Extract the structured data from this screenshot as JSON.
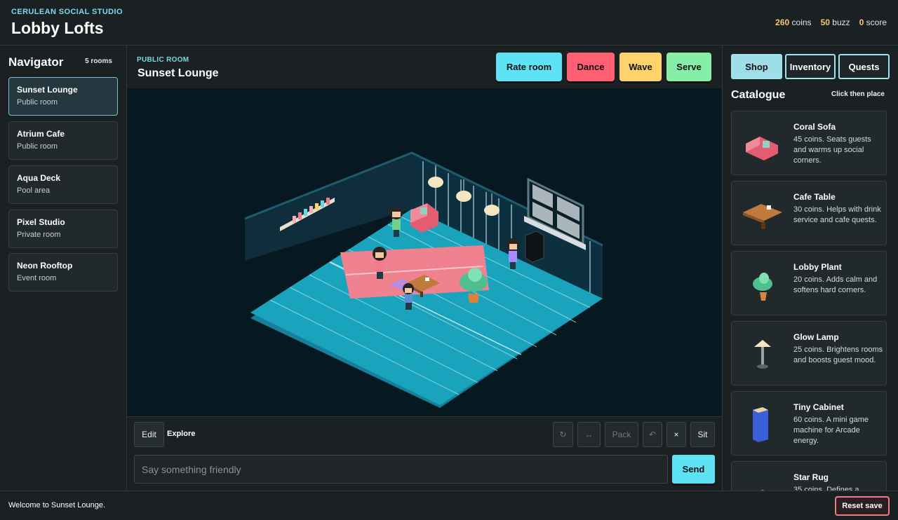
{
  "header": {
    "studio": "CERULEAN SOCIAL STUDIO",
    "title": "Lobby Lofts"
  },
  "stats": {
    "coins_value": "260",
    "coins_label": "coins",
    "buzz_value": "50",
    "buzz_label": "buzz",
    "score_value": "0",
    "score_label": "score"
  },
  "navigator": {
    "title": "Navigator",
    "count": "5 rooms",
    "rooms": [
      {
        "name": "Sunset Lounge",
        "type": "Public room"
      },
      {
        "name": "Atrium Cafe",
        "type": "Public room"
      },
      {
        "name": "Aqua Deck",
        "type": "Pool area"
      },
      {
        "name": "Pixel Studio",
        "type": "Private room"
      },
      {
        "name": "Neon Rooftop",
        "type": "Event room"
      }
    ]
  },
  "room": {
    "type": "PUBLIC ROOM",
    "name": "Sunset Lounge"
  },
  "actions": {
    "rate": "Rate room",
    "dance": "Dance",
    "wave": "Wave",
    "serve": "Serve"
  },
  "colors": {
    "rate": "#5ee3f4",
    "dance": "#ff5f73",
    "wave": "#ffd36b",
    "serve": "#86eea6",
    "floor": "#1aa3bd",
    "rug": "#f0828f"
  },
  "toolbar": {
    "edit": "Edit",
    "mode": "Explore",
    "rotate": "↻",
    "flip": "↔",
    "pack": "Pack",
    "undo": "↶",
    "remove": "×",
    "sit": "Sit",
    "chat_placeholder": "Say something friendly",
    "send": "Send"
  },
  "sidebar": {
    "tabs": {
      "shop": "Shop",
      "inventory": "Inventory",
      "quests": "Quests"
    },
    "catalogue_title": "Catalogue",
    "hint": "Click then place"
  },
  "catalogue": [
    {
      "name": "Coral Sofa",
      "desc": "45 coins. Seats guests and warms up social corners.",
      "icon": "sofa-icon"
    },
    {
      "name": "Cafe Table",
      "desc": "30 coins. Helps with drink service and cafe quests.",
      "icon": "table-icon"
    },
    {
      "name": "Lobby Plant",
      "desc": "20 coins. Adds calm and softens hard corners.",
      "icon": "plant-icon"
    },
    {
      "name": "Glow Lamp",
      "desc": "25 coins. Brightens rooms and boosts guest mood.",
      "icon": "lamp-icon"
    },
    {
      "name": "Tiny Cabinet",
      "desc": "60 coins. A mini game machine for Arcade energy.",
      "icon": "cabinet-icon"
    },
    {
      "name": "Star Rug",
      "desc": "35 coins. Defines a",
      "icon": "rug-icon"
    }
  ],
  "footer": {
    "status": "Welcome to Sunset Lounge.",
    "reset": "Reset save"
  }
}
